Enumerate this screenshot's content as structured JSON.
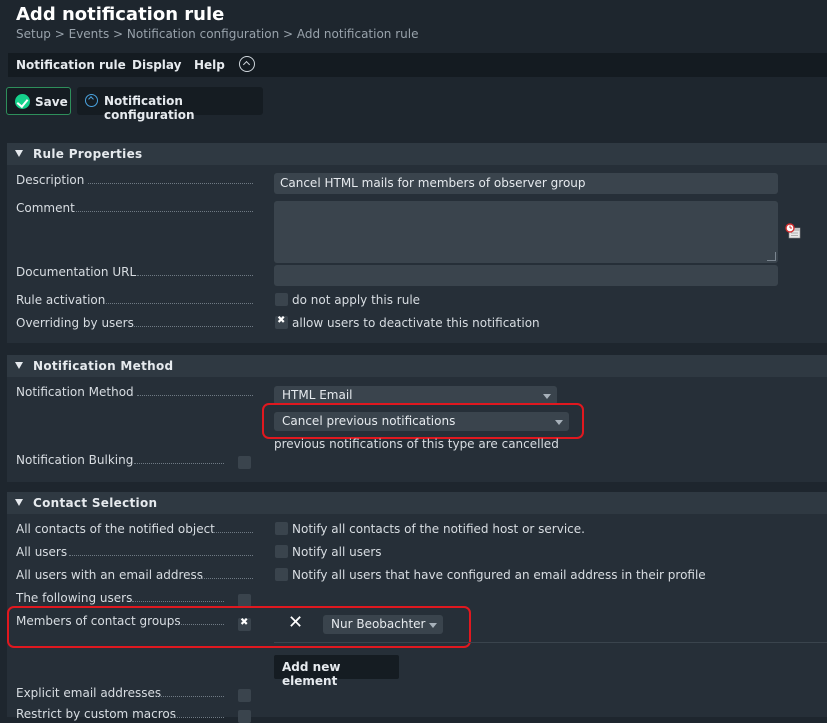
{
  "page": {
    "title": "Add notification rule",
    "breadcrumb": "Setup > Events > Notification configuration > Add notification rule"
  },
  "menubar": {
    "items": [
      "Notification rule",
      "Display",
      "Help"
    ]
  },
  "toolbar": {
    "save_label": "Save",
    "conf_label": "Notification configuration"
  },
  "sections": {
    "rule_properties": {
      "title": "Rule Properties",
      "description_label": "Description",
      "description_value": "Cancel HTML mails for members of observer group",
      "comment_label": "Comment",
      "doc_url_label": "Documentation URL",
      "rule_activation_label": "Rule activation",
      "rule_activation_text": "do not apply this rule",
      "overriding_label": "Overriding by users",
      "overriding_text": "allow users to deactivate this notification"
    },
    "notification_method": {
      "title": "Notification Method",
      "method_label": "Notification Method",
      "method_value": "HTML Email",
      "cancel_value": "Cancel previous notifications",
      "cancel_help": "previous notifications of this type are cancelled",
      "bulking_label": "Notification Bulking"
    },
    "contact_selection": {
      "title": "Contact Selection",
      "all_contacts_label": "All contacts of the notified object",
      "all_contacts_text": "Notify all contacts of the notified host or service.",
      "all_users_label": "All users",
      "all_users_text": "Notify all users",
      "all_users_email_label": "All users with an email address",
      "all_users_email_text": "Notify all users that have configured an email address in their profile",
      "following_users_label": "The following users",
      "members_groups_label": "Members of contact groups",
      "group_value": "Nur Beobachter",
      "add_element_label": "Add new element",
      "explicit_email_label": "Explicit email addresses",
      "restrict_macros_label": "Restrict by custom macros"
    }
  },
  "colors": {
    "background": "#1e262e",
    "accent_green": "#15d18b",
    "highlight_red": "#e0181f",
    "info_blue": "#4aa3df"
  }
}
